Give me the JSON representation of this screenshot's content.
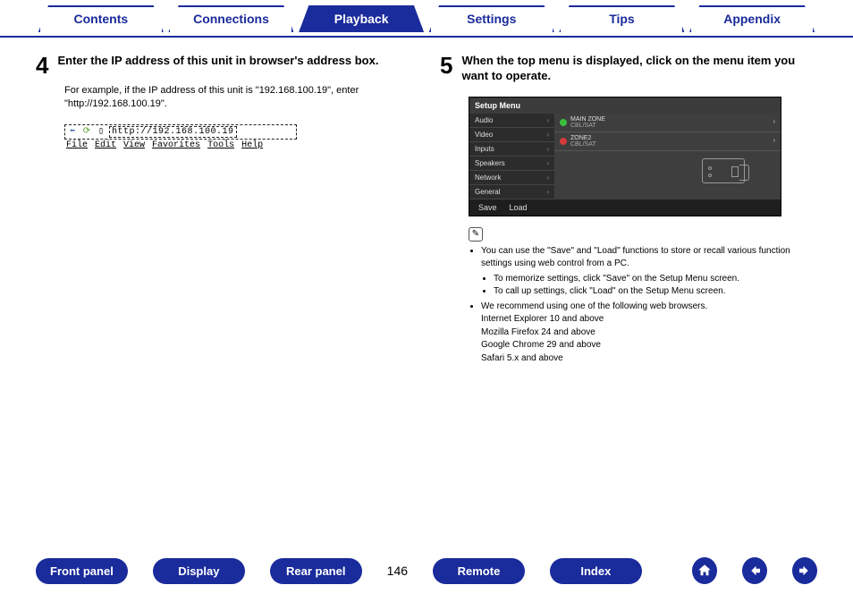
{
  "tabs": {
    "contents": "Contents",
    "connections": "Connections",
    "playback": "Playback",
    "settings": "Settings",
    "tips": "Tips",
    "appendix": "Appendix"
  },
  "step4": {
    "num": "4",
    "title": "Enter the IP address of this unit in browser's address box.",
    "desc": "For example, if the IP address of this unit is \"192.168.100.19\", enter \"http://192.168.100.19\".",
    "url": "http://192.168.100.19",
    "menus": {
      "file": "File",
      "edit": "Edit",
      "view": "View",
      "fav": "Favorites",
      "tools": "Tools",
      "help": "Help"
    }
  },
  "step5": {
    "num": "5",
    "title": "When the top menu is displayed, click on the menu item you want to operate.",
    "setup_title": "Setup Menu",
    "left_items": [
      "Audio",
      "Video",
      "Inputs",
      "Speakers",
      "Network",
      "General"
    ],
    "zone1": {
      "label": "MAIN ZONE",
      "sub": "CBL/SAT"
    },
    "zone2": {
      "label": "ZONE2",
      "sub": "CBL/SAT"
    },
    "save": "Save",
    "load": "Load"
  },
  "notes": {
    "b1": "You can use the \"Save\" and \"Load\" functions to store or recall various function settings using web control from a PC.",
    "b1a": "To memorize settings, click \"Save\" on the Setup Menu screen.",
    "b1b": "To call up settings, click \"Load\" on the Setup Menu screen.",
    "b2": "We recommend using one of the following web browsers.",
    "br1": "Internet Explorer 10 and above",
    "br2": "Mozilla Firefox 24 and above",
    "br3": "Google Chrome 29 and above",
    "br4": "Safari 5.x and above"
  },
  "bottom": {
    "front": "Front panel",
    "display": "Display",
    "rear": "Rear panel",
    "page": "146",
    "remote": "Remote",
    "index": "Index"
  }
}
